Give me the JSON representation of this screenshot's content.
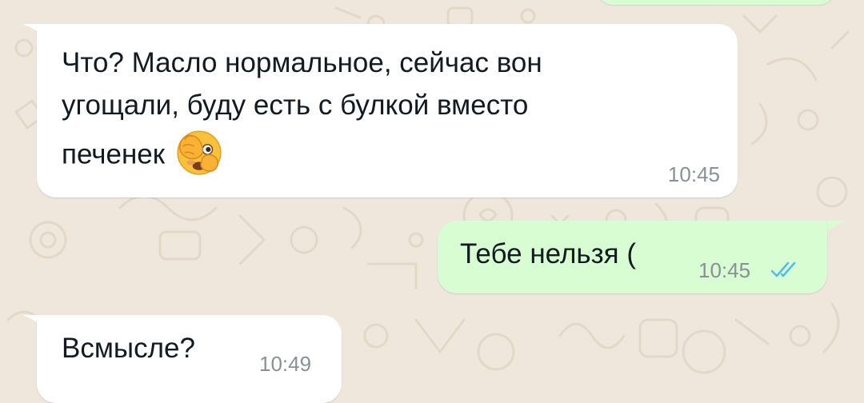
{
  "messages": [
    {
      "direction": "incoming",
      "lines": [
        "Что? Масло нормальное, сейчас вон",
        "угощали, буду есть с булкой вместо",
        "печенек"
      ],
      "emoji": "face-with-hand-over-eyes",
      "time": "10:45"
    },
    {
      "direction": "outgoing",
      "text": "Тебе нельзя (",
      "time": "10:45",
      "status": "read"
    },
    {
      "direction": "incoming",
      "text": "Всмысле?",
      "time": "10:49"
    }
  ],
  "colors": {
    "background": "#efe7dc",
    "incoming_bubble": "#ffffff",
    "outgoing_bubble": "#d8fdd2",
    "read_ticks": "#53bdeb",
    "timestamp": "#8a9196"
  }
}
